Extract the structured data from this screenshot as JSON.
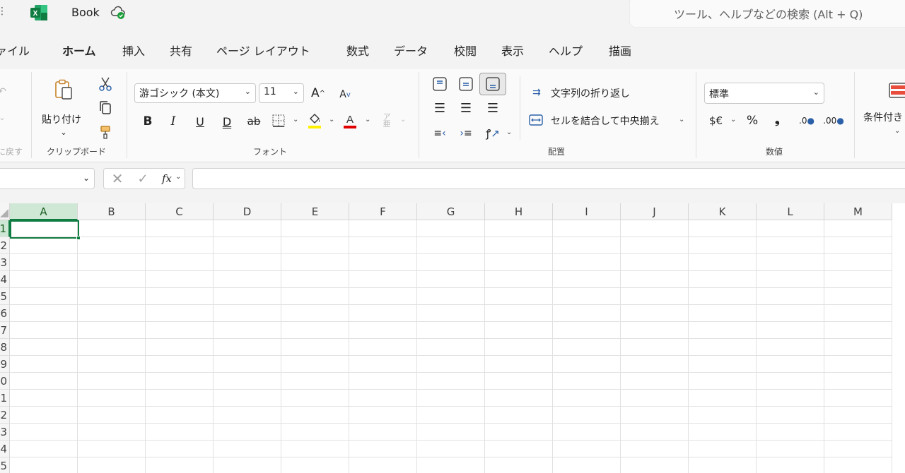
{
  "titlebar": {
    "book_title": "Book",
    "search_placeholder": "ツール、ヘルプなどの検索 (Alt + Q)"
  },
  "tabs": [
    {
      "label": "ァイル",
      "active": false
    },
    {
      "label": "ホーム",
      "active": true
    },
    {
      "label": "挿入",
      "active": false
    },
    {
      "label": "共有",
      "active": false
    },
    {
      "label": "ページ レイアウト",
      "active": false
    },
    {
      "label": "数式",
      "active": false
    },
    {
      "label": "データ",
      "active": false
    },
    {
      "label": "校閲",
      "active": false
    },
    {
      "label": "表示",
      "active": false
    },
    {
      "label": "ヘルプ",
      "active": false
    },
    {
      "label": "描画",
      "active": false
    }
  ],
  "ribbon": {
    "undo_label": "に戻す",
    "clipboard": {
      "paste_label": "貼り付け",
      "group_label": "クリップボード"
    },
    "font": {
      "font_name": "游ゴシック (本文)",
      "font_size": "11",
      "bold": "B",
      "italic": "I",
      "underline": "U",
      "double_underline": "D",
      "strikethrough": "ab",
      "group_label": "フォント"
    },
    "alignment": {
      "wrap_text_label": "文字列の折り返し",
      "merge_center_label": "セルを結合して中央揃え",
      "group_label": "配置"
    },
    "number": {
      "format": "標準",
      "currency": "$€",
      "percent": "%",
      "comma": "❟",
      "group_label": "数値"
    },
    "styles": {
      "conditional_label": "条件付き"
    }
  },
  "formula_bar": {
    "name_box_value": "",
    "formula_value": "",
    "fx_label": "fx"
  },
  "grid": {
    "columns": [
      "A",
      "B",
      "C",
      "D",
      "E",
      "F",
      "G",
      "H",
      "I",
      "J",
      "K",
      "L",
      "M"
    ],
    "rows": [
      "1",
      "2",
      "3",
      "4",
      "5",
      "6",
      "7",
      "8",
      "9",
      "0",
      "1",
      "2",
      "3",
      "4",
      "5"
    ],
    "selected_column": "A",
    "selected_row": "1",
    "accent_color": "#107c41"
  }
}
